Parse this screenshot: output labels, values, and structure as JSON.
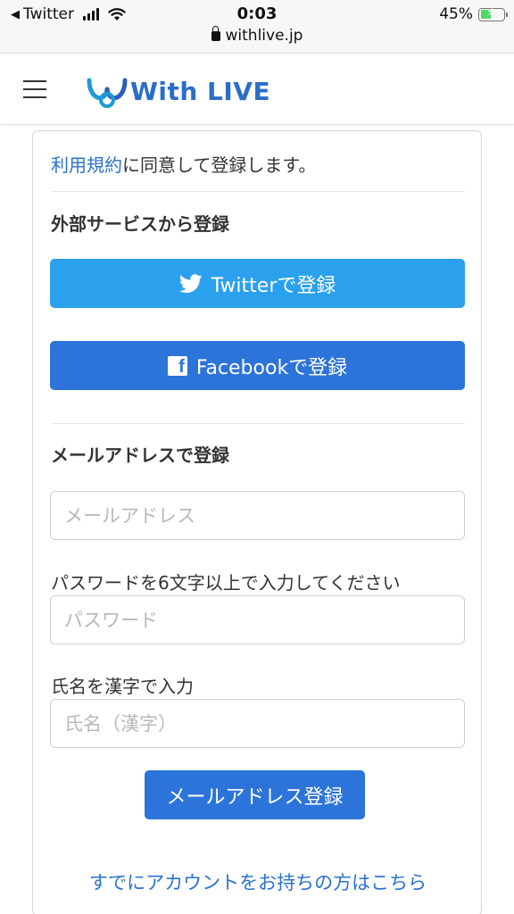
{
  "status_bar": {
    "back_app": "Twitter",
    "time": "0:03",
    "battery": "45%",
    "battery_level": 0.45,
    "url": "withlive.jp"
  },
  "header": {
    "logo_text": "With LIVE"
  },
  "form": {
    "terms_link": "利用規約",
    "terms_rest": "に同意して登録します。",
    "external_title": "外部サービスから登録",
    "twitter_button": "Twitterで登録",
    "facebook_button": "Facebookで登録",
    "email_title": "メールアドレスで登録",
    "email_placeholder": "メールアドレス",
    "password_label": "パスワードを6文字以上で入力してください",
    "password_placeholder": "パスワード",
    "name_label": "氏名を漢字で入力",
    "name_placeholder": "氏名（漢字）",
    "submit_button": "メールアドレス登録",
    "login_link": "すでにアカウントをお持ちの方はこちら"
  },
  "colors": {
    "twitter": "#2ba0ec",
    "facebook": "#2c74d9",
    "link": "#2a72d0",
    "brand": "#2a6ec6"
  }
}
